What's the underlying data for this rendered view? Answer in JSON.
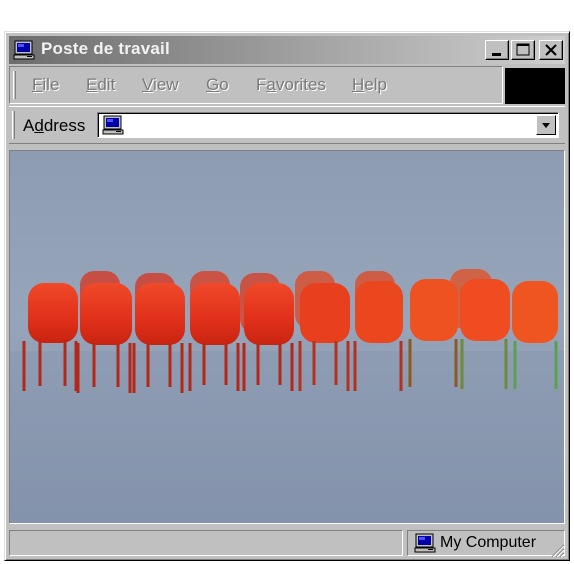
{
  "window": {
    "title": "Poste de travail",
    "title_icon": "my-computer-icon"
  },
  "menu": {
    "items": [
      {
        "label": "File"
      },
      {
        "label": "Edit"
      },
      {
        "label": "View"
      },
      {
        "label": "Go"
      },
      {
        "label": "Favorites"
      },
      {
        "label": "Help"
      }
    ]
  },
  "address": {
    "label": "Address",
    "value": "",
    "icon": "my-computer-icon"
  },
  "content": {
    "image": "red-chairs-row",
    "background_color": "#8e9db4",
    "chair_color": "#e8321c"
  },
  "status": {
    "left_text": "",
    "zone_text": "My Computer",
    "zone_icon": "my-computer-icon"
  },
  "colors": {
    "title_gradient_start": "#6d6d6d",
    "title_gradient_end": "#cfcfcf",
    "chrome": "#c0c0c0"
  }
}
